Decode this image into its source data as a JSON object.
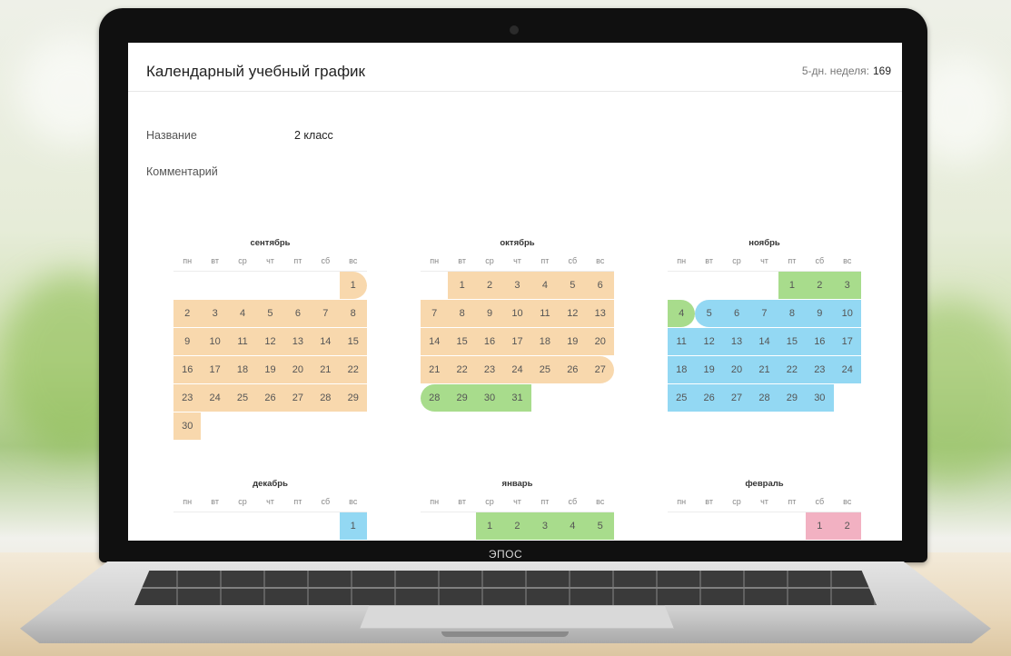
{
  "app": {
    "title": "Календарный учебный график",
    "week_label": "5-дн. неделя:",
    "week_value": "169",
    "brand": "ЭПОС"
  },
  "form": {
    "name_label": "Название",
    "name_value": "2 класс",
    "comment_label": "Комментарий"
  },
  "calendar": {
    "weekdays": [
      "пн",
      "вт",
      "ср",
      "чт",
      "пт",
      "сб",
      "вс"
    ],
    "colors": {
      "o": "#f8d8ad",
      "g": "#a8dc8c",
      "b": "#93d8f3",
      "p": "#f2b1c2"
    },
    "months": [
      {
        "name": "сентябрь",
        "offset": 6,
        "days": 30,
        "spans": [
          {
            "from": 1,
            "to": 30,
            "color": "o"
          }
        ],
        "round_left": [
          1
        ],
        "round_right": [
          1
        ]
      },
      {
        "name": "октябрь",
        "offset": 1,
        "days": 31,
        "spans": [
          {
            "from": 1,
            "to": 27,
            "color": "o"
          },
          {
            "from": 28,
            "to": 31,
            "color": "g"
          }
        ],
        "round_left": [
          28
        ],
        "round_right": [
          27
        ]
      },
      {
        "name": "ноябрь",
        "offset": 4,
        "days": 30,
        "spans": [
          {
            "from": 1,
            "to": 4,
            "color": "g"
          },
          {
            "from": 5,
            "to": 30,
            "color": "b"
          }
        ],
        "round_left": [
          5
        ],
        "round_right": [
          4
        ]
      },
      {
        "name": "декабрь",
        "offset": 6,
        "days": 1,
        "spans": [
          {
            "from": 1,
            "to": 1,
            "color": "b"
          }
        ],
        "round_left": [],
        "round_right": []
      },
      {
        "name": "январь",
        "offset": 2,
        "days": 5,
        "spans": [
          {
            "from": 1,
            "to": 5,
            "color": "g"
          }
        ],
        "round_left": [],
        "round_right": []
      },
      {
        "name": "февраль",
        "offset": 5,
        "days": 2,
        "spans": [
          {
            "from": 1,
            "to": 2,
            "color": "p"
          }
        ],
        "round_left": [],
        "round_right": []
      }
    ]
  }
}
